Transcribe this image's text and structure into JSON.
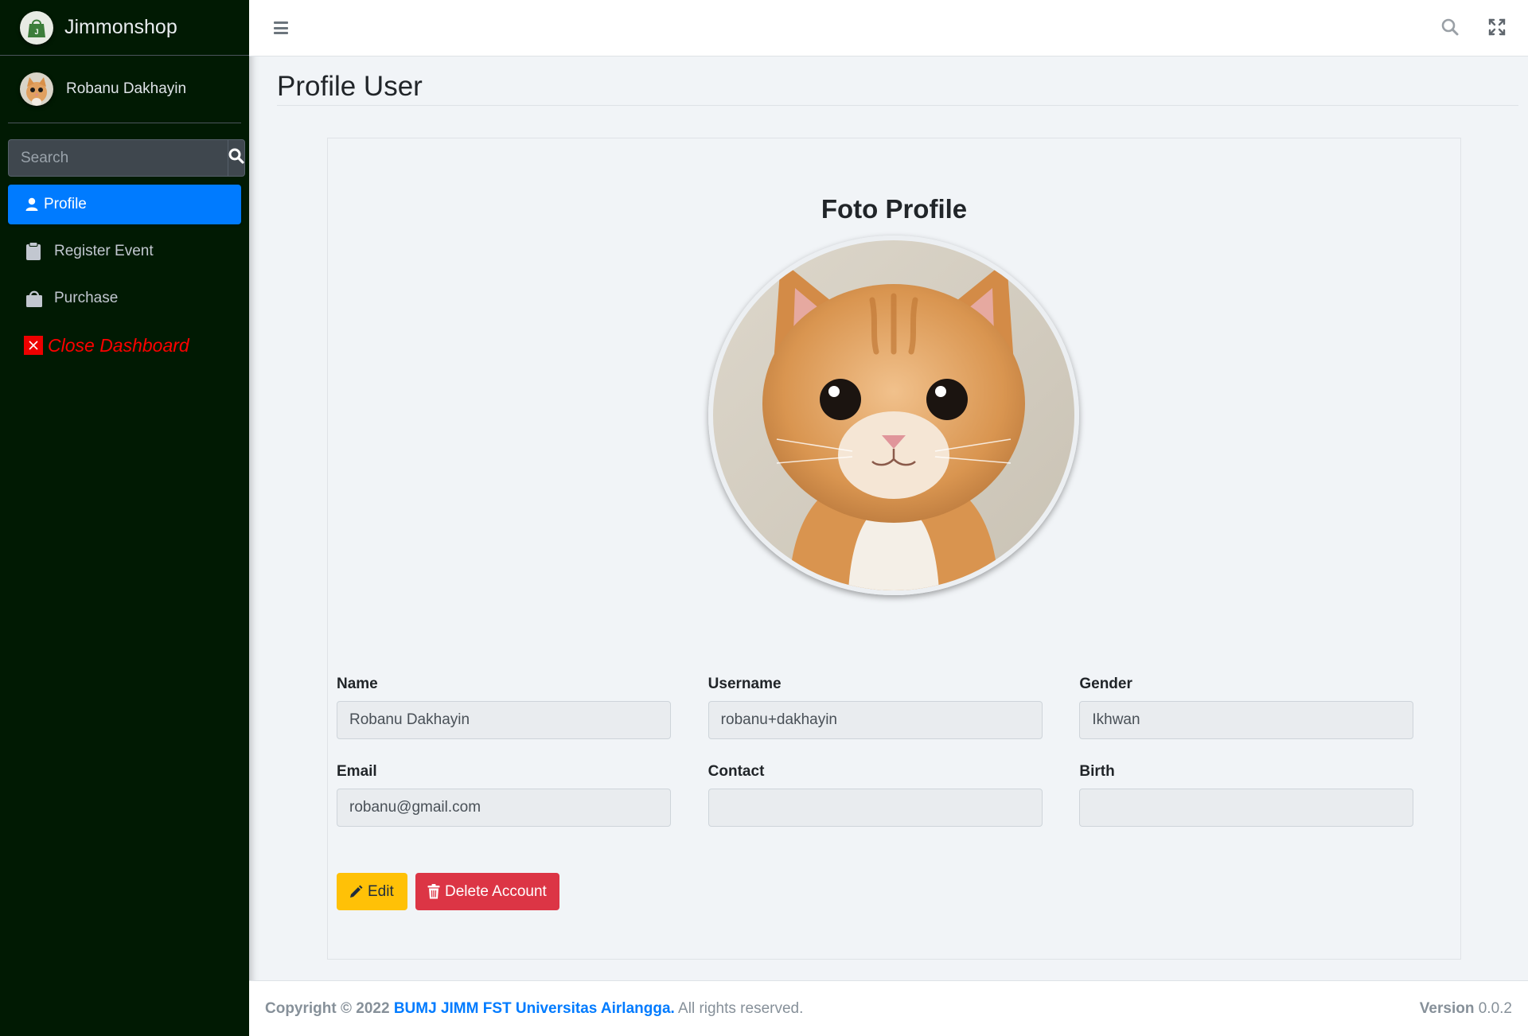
{
  "brand": {
    "name": "Jimmonshop",
    "logo_icon": "shop-bag-logo-icon"
  },
  "user": {
    "name": "Robanu Dakhayin",
    "avatar": "kitten-avatar"
  },
  "sidebar": {
    "search": {
      "placeholder": "Search",
      "icon": "search-icon"
    },
    "items": [
      {
        "label": "Profile",
        "icon": "user-icon",
        "active": true
      },
      {
        "label": "Register Event",
        "icon": "clipboard-icon",
        "active": false
      },
      {
        "label": "Purchase",
        "icon": "shopping-bag-icon",
        "active": false
      },
      {
        "label": "Close Dashboard",
        "icon": "close-square-icon",
        "active": false
      }
    ]
  },
  "topbar": {
    "menu_icon": "hamburger-icon",
    "search_icon": "search-icon",
    "expand_icon": "expand-icon"
  },
  "page": {
    "title": "Profile User"
  },
  "profile": {
    "photo_title": "Foto Profile",
    "fields": {
      "name": {
        "label": "Name",
        "value": "Robanu Dakhayin"
      },
      "username": {
        "label": "Username",
        "value": "robanu+dakhayin"
      },
      "gender": {
        "label": "Gender",
        "value": "Ikhwan"
      },
      "email": {
        "label": "Email",
        "value": "robanu@gmail.com"
      },
      "contact": {
        "label": "Contact",
        "value": ""
      },
      "birth": {
        "label": "Birth",
        "value": ""
      }
    },
    "buttons": {
      "edit": "Edit",
      "delete": "Delete Account"
    }
  },
  "footer": {
    "copyright_prefix": "Copyright © 2022",
    "organization": "BUMJ JIMM FST Universitas Airlangga.",
    "rights": "All rights reserved.",
    "version_label": "Version",
    "version_value": "0.0.2"
  },
  "colors": {
    "sidebar_bg": "#011a03",
    "active_blue": "#007bff",
    "edit_yellow": "#ffc107",
    "delete_red": "#dc3545",
    "close_red": "#ff0000"
  }
}
